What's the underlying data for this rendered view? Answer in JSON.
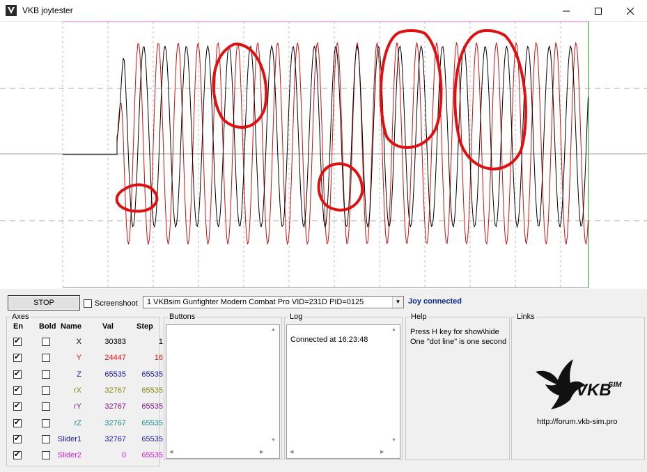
{
  "window": {
    "title": "VKB joytester"
  },
  "controls": {
    "stop_label": "STOP",
    "screenshot_label": "Screenshoot",
    "screenshot_checked": false,
    "device": "1  VKBsim Gunfighter Modern Combat Pro  VID=231D PID=0125",
    "status": "Joy connected",
    "status_color": "#0a2a8c"
  },
  "axes": {
    "title": "Axes",
    "headers": {
      "en": "En",
      "bold": "Bold",
      "name": "Name",
      "val": "Val",
      "step": "Step"
    },
    "rows": [
      {
        "name": "X",
        "val": "30383",
        "step": "1",
        "color": "#000000",
        "en": true,
        "bold": false
      },
      {
        "name": "Y",
        "val": "24447",
        "step": "16",
        "color": "#e01010",
        "en": true,
        "bold": false
      },
      {
        "name": "Z",
        "val": "65535",
        "step": "65535",
        "color": "#1a1aa6",
        "en": true,
        "bold": false
      },
      {
        "name": "rX",
        "val": "32767",
        "step": "65535",
        "color": "#8a8a18",
        "en": true,
        "bold": false
      },
      {
        "name": "rY",
        "val": "32767",
        "step": "65535",
        "color": "#8a1a8a",
        "en": true,
        "bold": false
      },
      {
        "name": "rZ",
        "val": "32767",
        "step": "65535",
        "color": "#1a8a8a",
        "en": true,
        "bold": false
      },
      {
        "name": "Slider1",
        "val": "32767",
        "step": "65535",
        "color": "#1a1aa6",
        "en": true,
        "bold": false
      },
      {
        "name": "Slider2",
        "val": "0",
        "step": "65535",
        "color": "#d41ad4",
        "en": true,
        "bold": false
      }
    ]
  },
  "buttons_panel": {
    "title": "Buttons"
  },
  "log_panel": {
    "title": "Log",
    "lines": [
      "Connected at 16:23:48"
    ]
  },
  "help_panel": {
    "title": "Help",
    "lines": [
      "Press H key for show\\hide",
      "One \"dot line\" is one second"
    ]
  },
  "links_panel": {
    "title": "Links",
    "logo_text": "VKBSIM",
    "url": "http://forum.vkb-sim.pro"
  },
  "plot": {
    "x_color": "#000000",
    "y_color": "#cc1111",
    "annotation_color": "#e01010"
  }
}
